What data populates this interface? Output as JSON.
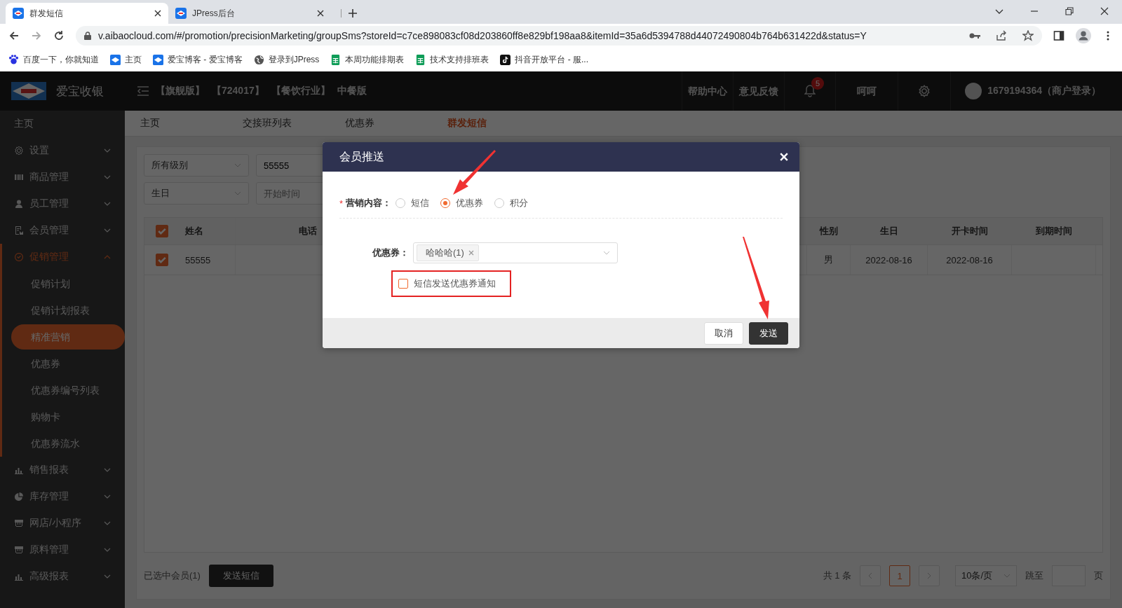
{
  "browser": {
    "tabs": [
      {
        "title": "群发短信",
        "selected": true
      },
      {
        "title": "JPress后台",
        "selected": false
      }
    ],
    "url": "v.aibaocloud.com/#/promotion/precisionMarketing/groupSms?storeId=c7ce898083cf08d203860ff8e829bf198aa8&itemId=35a6d5394788d44072490804b764b631422d&status=Y",
    "bookmarks": [
      "百度一下，你就知道",
      "主页",
      "爱宝博客 - 爱宝博客",
      "登录到JPress",
      "本周功能排期表",
      "技术支持排班表",
      "抖音开放平台 - 服..."
    ]
  },
  "header": {
    "logo_text": "爱宝收银",
    "edition_tags": [
      "【旗舰版】",
      "【724017】",
      "【餐饮行业】",
      "中餐版"
    ],
    "links": [
      "帮助中心",
      "意见反馈"
    ],
    "notification_count": "5",
    "user_name": "呵呵",
    "account": "1679194364（商户登录）"
  },
  "sidebar": {
    "items": [
      {
        "label": "主页",
        "expanded": false
      },
      {
        "label": "设置",
        "expanded": false
      },
      {
        "label": "商品管理",
        "expanded": false
      },
      {
        "label": "员工管理",
        "expanded": false
      },
      {
        "label": "会员管理",
        "expanded": false
      },
      {
        "label": "促销管理",
        "expanded": true,
        "children": [
          {
            "label": "促销计划",
            "selected": false
          },
          {
            "label": "促销计划报表",
            "selected": false
          },
          {
            "label": "精准营销",
            "selected": true
          },
          {
            "label": "优惠券",
            "selected": false
          },
          {
            "label": "优惠券编号列表",
            "selected": false
          },
          {
            "label": "购物卡",
            "selected": false
          },
          {
            "label": "优惠券流水",
            "selected": false
          }
        ]
      },
      {
        "label": "销售报表",
        "expanded": false
      },
      {
        "label": "库存管理",
        "expanded": false
      },
      {
        "label": "网店/小程序",
        "expanded": false
      },
      {
        "label": "原料管理",
        "expanded": false
      },
      {
        "label": "高级报表",
        "expanded": false
      }
    ]
  },
  "page_tabs": [
    {
      "label": "主页",
      "selected": false
    },
    {
      "label": "交接班列表",
      "selected": false
    },
    {
      "label": "优惠券",
      "selected": false
    },
    {
      "label": "群发短信",
      "selected": true
    }
  ],
  "filters": {
    "level": "所有级别",
    "keyword": "55555",
    "date_type": "生日",
    "start_date": {
      "placeholder": "开始时间"
    }
  },
  "table": {
    "all_checked": true,
    "columns": [
      "姓名",
      "电话",
      "性别",
      "生日",
      "开卡时间",
      "到期时间"
    ],
    "rows": [
      {
        "checked": true,
        "cells": [
          "55555",
          "",
          "男",
          "2022-08-16",
          "2022-08-16",
          ""
        ]
      }
    ]
  },
  "footer": {
    "selected_label": "已选中会员(1)",
    "send_button": "发送短信",
    "total": "共 1 条",
    "pages": [
      {
        "label": "1",
        "selected": true
      }
    ],
    "page_size": "10条/页",
    "jump_label": "跳至",
    "page_unit": "页"
  },
  "modal": {
    "title": "会员推送",
    "content_label": "营销内容：",
    "required_mark": "*",
    "options": [
      {
        "label": "短信",
        "selected": false
      },
      {
        "label": "优惠券",
        "selected": true
      },
      {
        "label": "积分",
        "selected": false
      }
    ],
    "coupon_label": "优惠券：",
    "coupon_tags": [
      "哈哈哈(1)"
    ],
    "sms_notify": {
      "label": "短信发送优惠券通知",
      "checked": false
    },
    "cancel_button": "取消",
    "send_button": "发送"
  }
}
